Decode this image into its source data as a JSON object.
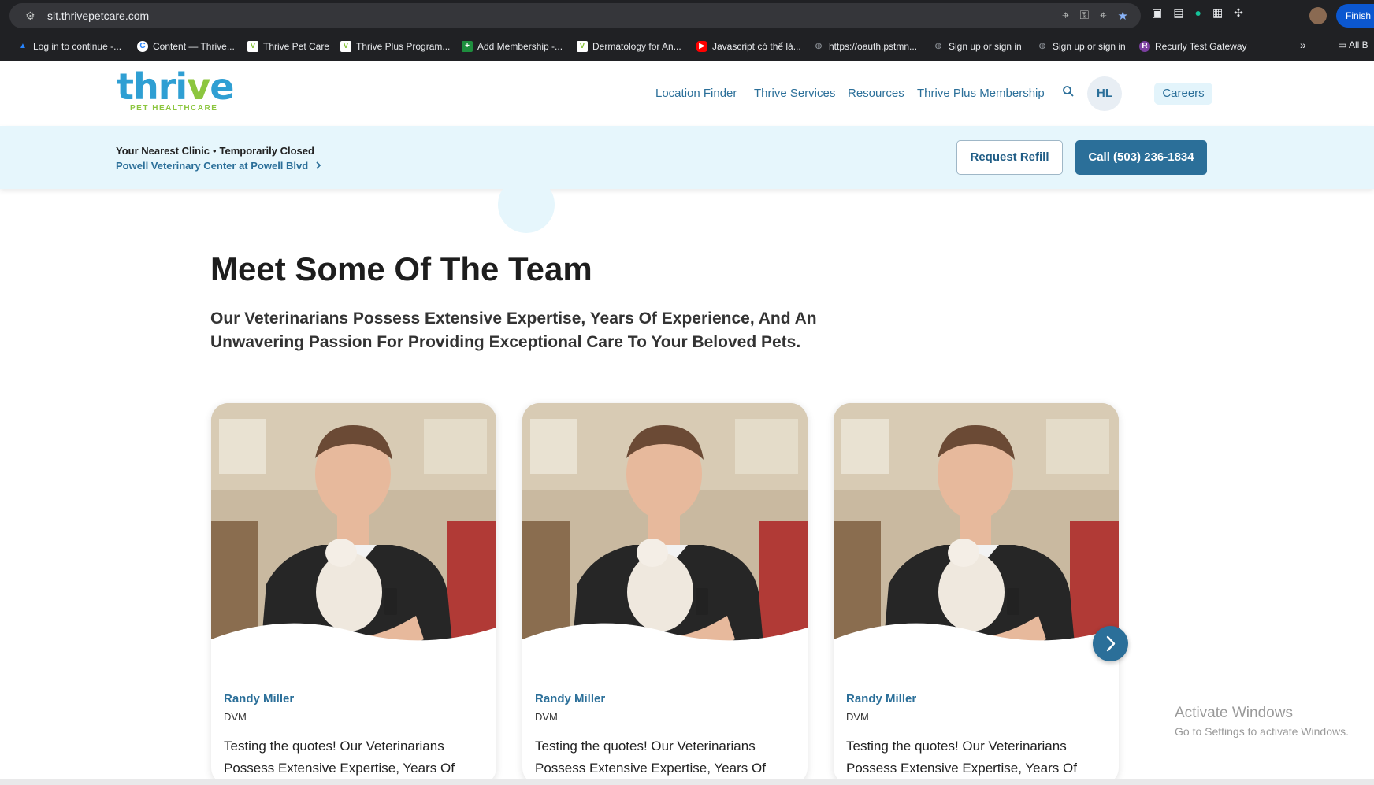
{
  "browser": {
    "url": "sit.thrivepetcare.com",
    "finish_label": "Finish u",
    "bookmarks": [
      {
        "label": "Log in to continue -...",
        "icon": "atlassian-icon",
        "color": "#2684ff"
      },
      {
        "label": "Content — Thrive...",
        "icon": "contentful-icon",
        "color": "#ffda00"
      },
      {
        "label": "Thrive Pet Care",
        "icon": "thrive-icon",
        "color": "#8cc63f"
      },
      {
        "label": "Thrive Plus Program...",
        "icon": "thrive-icon",
        "color": "#8cc63f"
      },
      {
        "label": "Add Membership -...",
        "icon": "plus-icon",
        "color": "#1e8e3e"
      },
      {
        "label": "Dermatology for An...",
        "icon": "thrive-icon",
        "color": "#8cc63f"
      },
      {
        "label": "Javascript có thể là...",
        "icon": "youtube-icon",
        "color": "#ff0000"
      },
      {
        "label": "https://oauth.pstmn...",
        "icon": "globe-icon",
        "color": "#9aa0a6"
      },
      {
        "label": "Sign up or sign in",
        "icon": "globe-icon",
        "color": "#9aa0a6"
      },
      {
        "label": "Sign up or sign in",
        "icon": "globe-icon",
        "color": "#9aa0a6"
      },
      {
        "label": "Recurly Test Gateway",
        "icon": "recurly-icon",
        "color": "#7b3fa0"
      }
    ],
    "all_bookmarks_label": "All B"
  },
  "header": {
    "logo_text_a": "thri",
    "logo_text_v": "v",
    "logo_text_b": "e",
    "logo_sub": "PET HEALTHCARE",
    "nav": [
      "Location Finder",
      "Thrive Services",
      "Resources",
      "Thrive Plus Membership"
    ],
    "avatar_initials": "HL",
    "careers_label": "Careers"
  },
  "clinic": {
    "label": "Your Nearest Clinic",
    "status": "Temporarily Closed",
    "name": "Powell Veterinary Center at Powell Blvd",
    "refill_label": "Request Refill",
    "call_label": "Call (503) 236-1834"
  },
  "team": {
    "title": "Meet Some Of The Team",
    "subtitle": "Our Veterinarians Possess Extensive Expertise, Years Of Experience, And An Unwavering Passion For Providing Exceptional Care To Your Beloved Pets.",
    "members": [
      {
        "name": "Randy Miller",
        "title": "DVM",
        "quote": "Testing the quotes! Our Veterinarians Possess Extensive Expertise, Years Of"
      },
      {
        "name": "Randy Miller",
        "title": "DVM",
        "quote": "Testing the quotes! Our Veterinarians Possess Extensive Expertise, Years Of"
      },
      {
        "name": "Randy Miller",
        "title": "DVM",
        "quote": "Testing the quotes! Our Veterinarians Possess Extensive Expertise, Years Of"
      }
    ]
  },
  "watermark": {
    "line1": "Activate Windows",
    "line2": "Go to Settings to activate Windows."
  }
}
